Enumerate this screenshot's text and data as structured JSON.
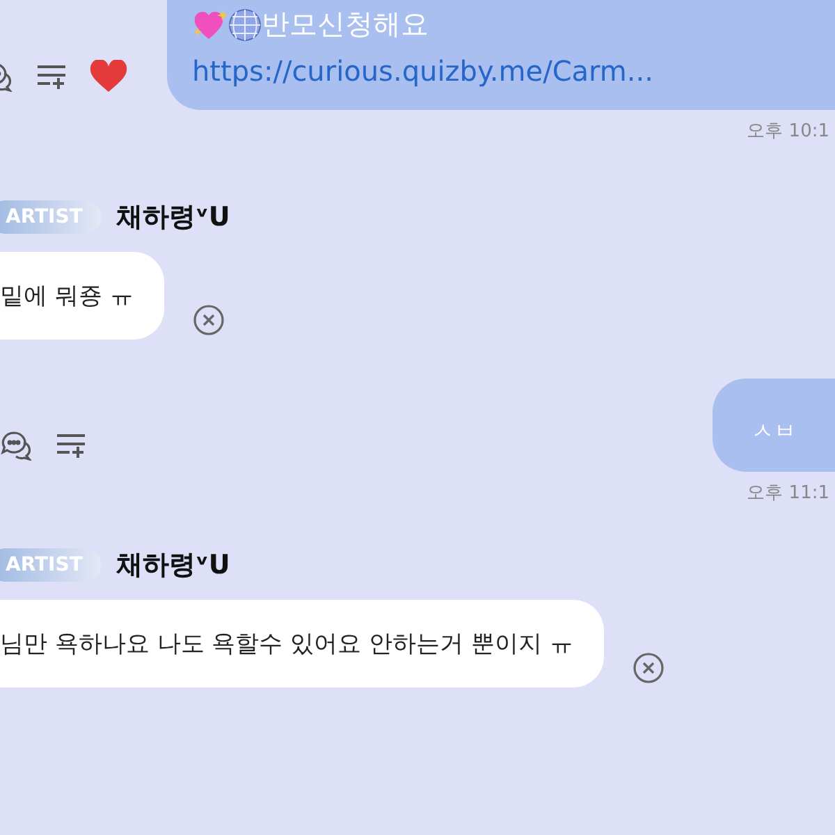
{
  "messages": [
    {
      "kind": "sent",
      "lines": [
        "반모신청해요"
      ],
      "link": "https://curious.quizby.me/Carm...",
      "emoji": true,
      "reaction": true,
      "time": "오후 10:1"
    },
    {
      "kind": "received",
      "badge": "ARTIST",
      "name": "채하령ᵛᑌ",
      "text": "밑에 뭐죵 ㅠ"
    },
    {
      "kind": "sent",
      "lines": [
        "ㅅㅂ"
      ],
      "emoji": false,
      "reaction": false,
      "time": "오후 11:1"
    },
    {
      "kind": "received",
      "badge": "ARTIST",
      "name": "채하령ᵛᑌ",
      "text": "님만 욕하나요 나도 욕할수 있어요 안하는거 뿐이지 ㅠ"
    }
  ]
}
